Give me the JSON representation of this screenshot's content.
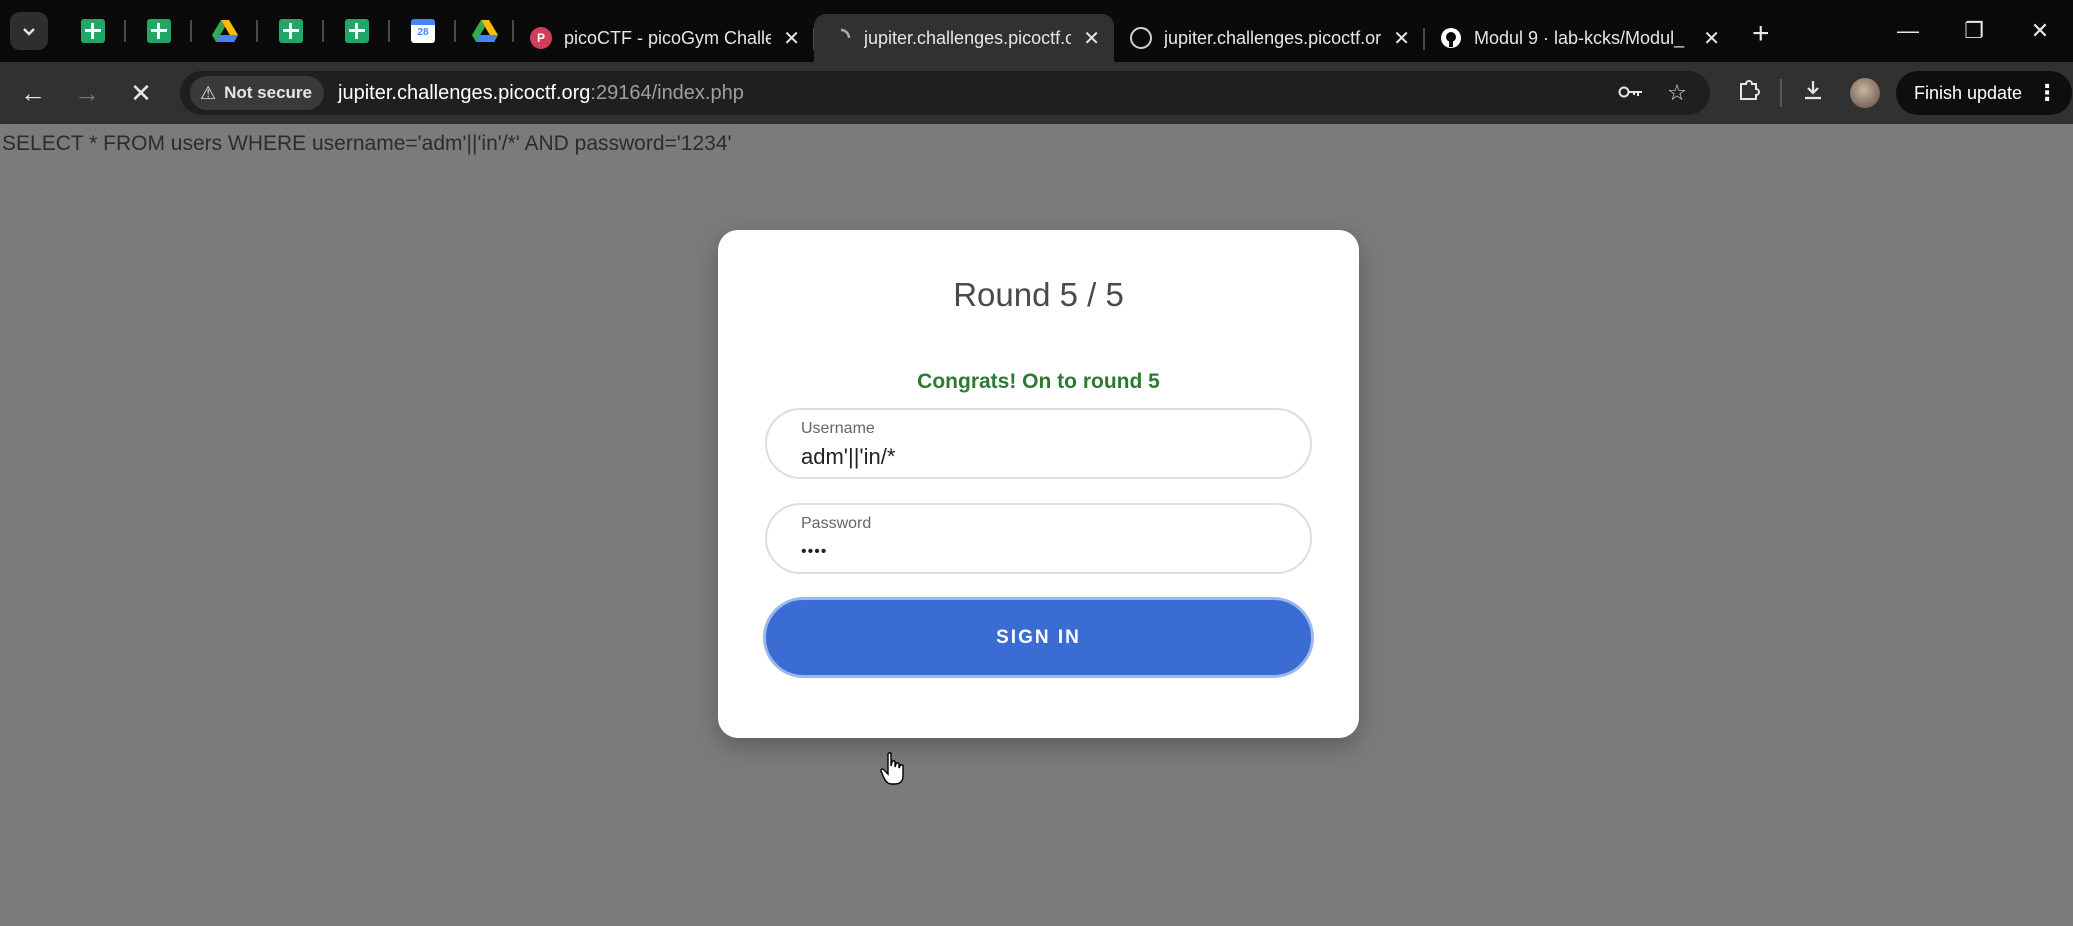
{
  "tabs": {
    "pinned": [
      "sheets-icon",
      "sheets-icon",
      "google-drive-icon",
      "sheets-icon",
      "sheets-icon",
      "google-calendar-icon",
      "google-drive-icon"
    ],
    "calendar_day": "28",
    "items": [
      {
        "title": "picoCTF - picoGym Challen",
        "icon": "picoctf-icon"
      },
      {
        "title": "jupiter.challenges.picoctf.or",
        "icon": "loading-icon",
        "active": true
      },
      {
        "title": "jupiter.challenges.picoctf.or",
        "icon": "globe-icon"
      },
      {
        "title": "Modul 9 · lab-kcks/Modul_",
        "icon": "github-icon"
      }
    ]
  },
  "toolbar": {
    "security_label": "Not secure",
    "url_host": "jupiter.challenges.picoctf.org",
    "url_rest": ":29164/index.php",
    "finish_update_label": "Finish update"
  },
  "page": {
    "sql_query": "SELECT * FROM users WHERE username='adm'||'in'/*' AND password='1234'",
    "round_title": "Round 5 / 5",
    "congrats_message": "Congrats! On to round 5",
    "username_label": "Username",
    "username_value": "adm'||'in/*",
    "password_label": "Password",
    "password_value": "••••",
    "signin_label": "SIGN IN"
  },
  "colors": {
    "button": "#3a6cd3",
    "success": "#2d7a32",
    "page_bg": "#7b7b7b"
  }
}
